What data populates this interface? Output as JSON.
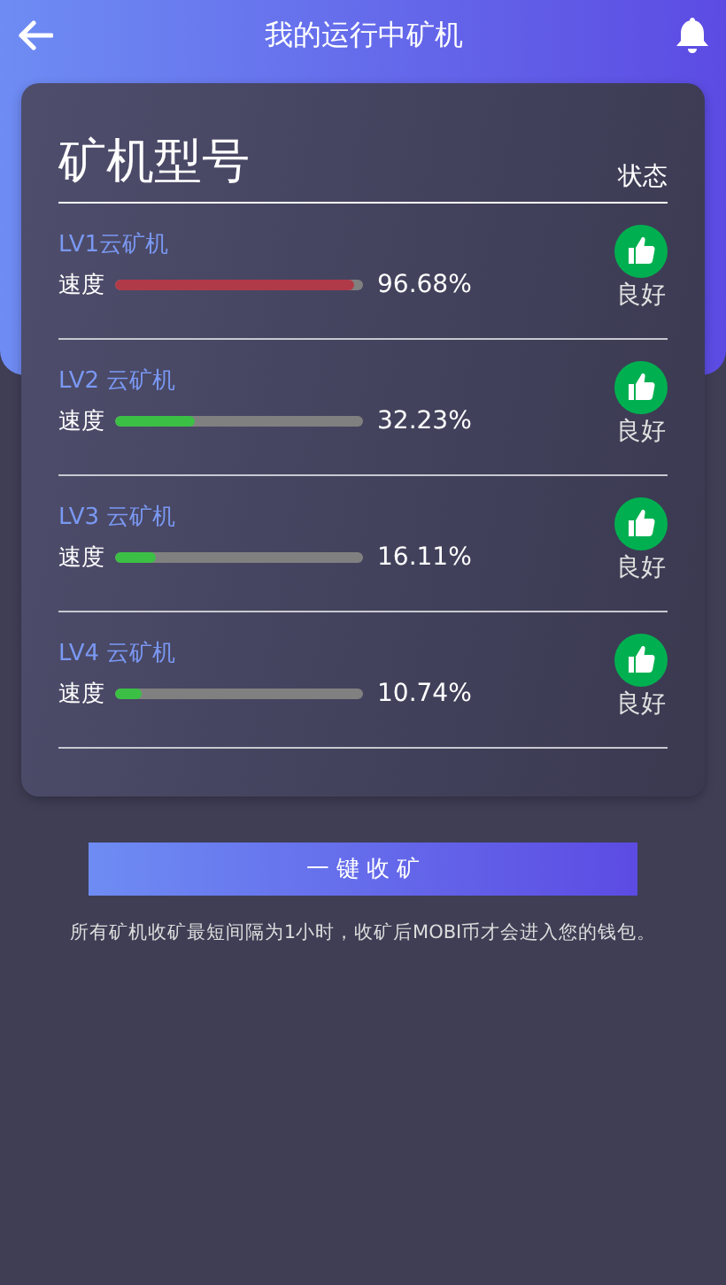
{
  "header": {
    "title": "我的运行中矿机"
  },
  "card": {
    "title": "矿机型号",
    "status_heading": "状态",
    "miners": [
      {
        "name": "LV1云矿机",
        "speed_label": "速度",
        "level": 0.9668,
        "color": "#b03a48",
        "reading": "96.68%",
        "status": "良好"
      },
      {
        "name": "LV2 云矿机",
        "speed_label": "速度",
        "level": 0.3223,
        "color": "#3cbf45",
        "reading": "32.23%",
        "status": "良好"
      },
      {
        "name": "LV3 云矿机",
        "speed_label": "速度",
        "level": 0.1611,
        "color": "#3cbf45",
        "reading": "16.11%",
        "status": "良好"
      },
      {
        "name": "LV4 云矿机",
        "speed_label": "速度",
        "level": 0.1074,
        "color": "#3cbf45",
        "reading": "10.74%",
        "status": "良好"
      }
    ]
  },
  "collect_button": "一 键 收 矿",
  "notice": "所有矿机收矿最短间隔为1小时，收矿后MOBI币才会进入您的钱包。"
}
